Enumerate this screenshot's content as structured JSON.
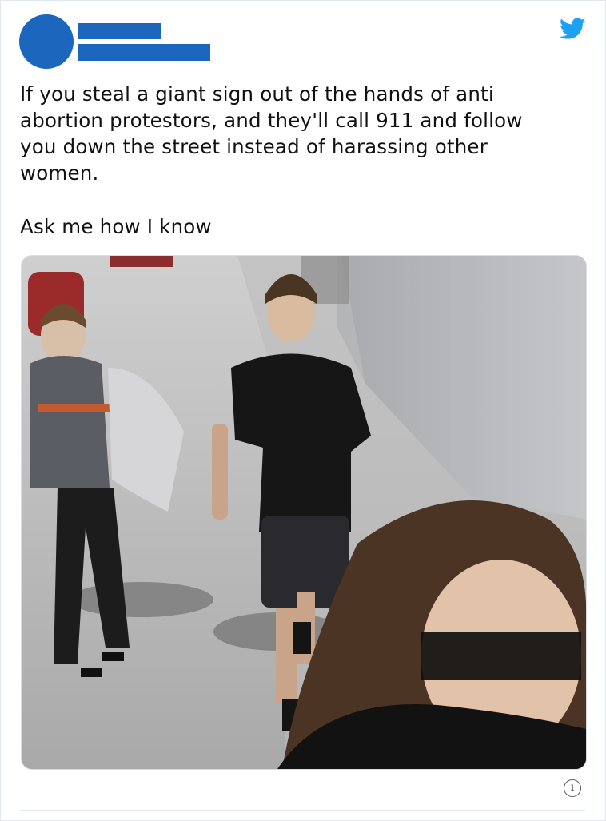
{
  "colors": {
    "redaction": "#1c66be",
    "twitter_blue": "#1da1f2"
  },
  "header": {
    "avatar": "redacted",
    "display_name": "redacted",
    "handle": "redacted",
    "logo_icon": "twitter-bird-icon"
  },
  "tweet": {
    "lines": [
      "If you steal a giant sign out of the hands of anti",
      "abortion protestors, and they'll call 911 and follow",
      "you down the street instead of harassing other",
      "women."
    ],
    "last_line": "Ask me how I know"
  },
  "footer": {
    "info_icon": "info-icon",
    "info_glyph": "i"
  }
}
